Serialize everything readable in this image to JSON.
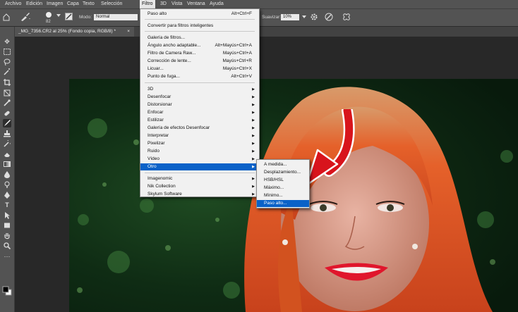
{
  "menubar": {
    "items": [
      "Archivo",
      "Edición",
      "Imagen",
      "Capa",
      "Texto",
      "Selección",
      "Filtro",
      "3D",
      "Vista",
      "Ventana",
      "Ayuda"
    ],
    "active_index": 6
  },
  "optbar": {
    "brush_size": "82",
    "mode_label": "Modo:",
    "mode_value": "Normal",
    "smoothing_label": "Suavizar:",
    "smoothing_value": "10%"
  },
  "document": {
    "tab_title": "_MG_7356.CR2 al 25% (Fondo copia, RGB/8) *"
  },
  "filter_menu": {
    "last_filter": {
      "label": "Paso alto",
      "shortcut": "Alt+Ctrl+F"
    },
    "smart_filters": "Convertir para filtros inteligentes",
    "group1": [
      {
        "label": "Galería de filtros...",
        "shortcut": ""
      },
      {
        "label": "Ángulo ancho adaptable...",
        "shortcut": "Alt+Mayús+Ctrl+A"
      },
      {
        "label": "Filtro de Camera Raw...",
        "shortcut": "Mayús+Ctrl+A"
      },
      {
        "label": "Corrección de lente...",
        "shortcut": "Mayús+Ctrl+R"
      },
      {
        "label": "Licuar...",
        "shortcut": "Mayús+Ctrl+X"
      },
      {
        "label": "Punto de fuga...",
        "shortcut": "Alt+Ctrl+V"
      }
    ],
    "group2": [
      "3D",
      "Desenfocar",
      "Distorsionar",
      "Enfocar",
      "Estilizar",
      "Galería de efectos Desenfocar",
      "Interpretar",
      "Pixelizar",
      "Ruido",
      "Vídeo",
      "Otro"
    ],
    "group2_highlight": "Otro",
    "group3": [
      "Imagenomic",
      "Nik Collection",
      "Skylum Software"
    ]
  },
  "submenu": {
    "items": [
      "A medida...",
      "Desplazamiento...",
      "HSB/HSL",
      "Máximo...",
      "Mínimo...",
      "Paso alto..."
    ],
    "highlight": "Paso alto..."
  },
  "colors": {
    "menu_highlight": "#0a62c8",
    "arrow": "#d8141c",
    "panel": "#535353"
  }
}
